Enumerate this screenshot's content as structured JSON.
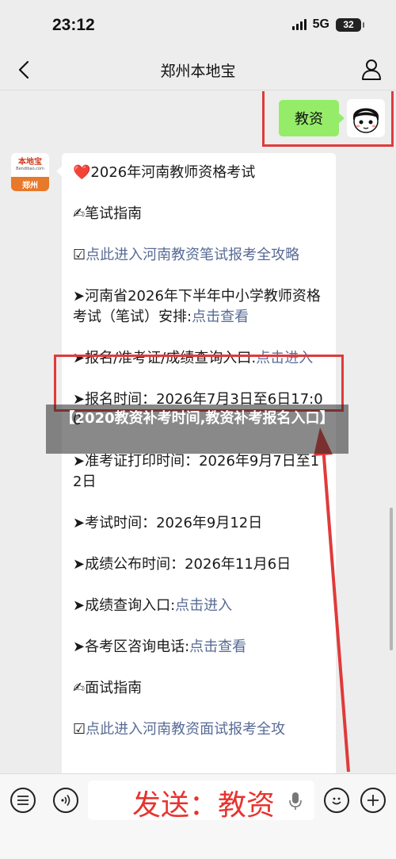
{
  "status_bar": {
    "time": "23:12",
    "network": "5G",
    "battery": "32"
  },
  "nav": {
    "title": "郑州本地宝"
  },
  "chat": {
    "user_message": "教资",
    "bot_avatar": {
      "logo_text": "本地宝",
      "logo_sub": "Bendibao.com",
      "city": "郑州"
    },
    "bot_message": {
      "lines": [
        {
          "prefix": "❤️2026年河南教师资格考试",
          "link": ""
        },
        {
          "prefix": "✍笔试指南",
          "link": ""
        },
        {
          "prefix": "☑",
          "link": "点此进入河南教资笔试报考全攻略"
        },
        {
          "prefix": "➤河南省2026年下半年中小学教师资格考试（笔试）安排:",
          "link": "点击查看"
        },
        {
          "prefix": "➤报名/准考证/成绩查询入口:",
          "link": "点击进入"
        },
        {
          "prefix": "➤报名时间：2026年7月3日至6日17:00",
          "link": ""
        },
        {
          "prefix": "➤准考证打印时间：2026年9月7日至12日",
          "link": ""
        },
        {
          "prefix": "➤考试时间：2026年9月12日",
          "link": ""
        },
        {
          "prefix": "➤成绩公布时间：2026年11月6日",
          "link": ""
        },
        {
          "prefix": "➤成绩查询入口:",
          "link": "点击进入"
        },
        {
          "prefix": "➤各考区咨询电话:",
          "link": "点击查看"
        },
        {
          "prefix": "✍面试指南",
          "link": ""
        },
        {
          "prefix": "☑",
          "link": "点此进入河南教资面试报考全攻"
        }
      ]
    }
  },
  "watermark": "【2020教资补考时间,教资补考报名入口】",
  "input": {
    "text": "发送：教资"
  },
  "colors": {
    "bubble_green": "#95ec69",
    "highlight_red": "#e03a3a",
    "link_blue": "#576b95"
  }
}
